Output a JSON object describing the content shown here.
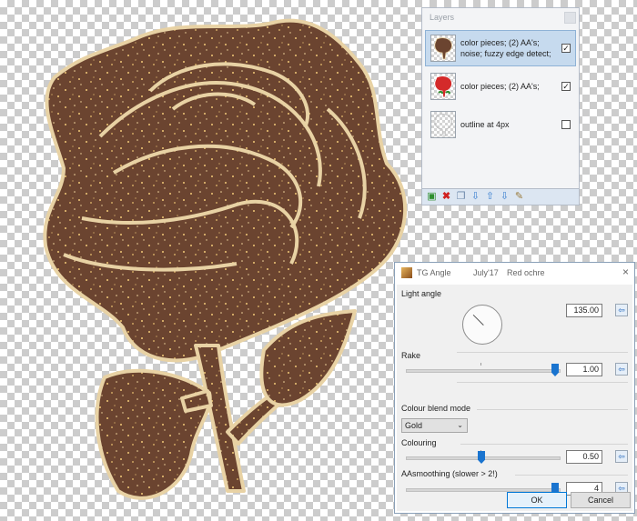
{
  "layers_panel": {
    "title": "Layers",
    "layers": [
      {
        "name": "color pieces; (2) AA's; noise; fuzzy edge detect;",
        "checked": true,
        "selected": true,
        "thumb": "brown-rose"
      },
      {
        "name": "color pieces; (2) AA's;",
        "checked": true,
        "selected": false,
        "thumb": "red-rose"
      },
      {
        "name": "outline at 4px",
        "checked": false,
        "selected": false,
        "thumb": "outline-rose"
      }
    ],
    "toolbar_icons": [
      "add-layer-icon",
      "delete-layer-icon",
      "duplicate-layer-icon",
      "merge-down-icon",
      "move-up-icon",
      "move-down-icon",
      "properties-icon"
    ],
    "check_mark": "✓"
  },
  "dialog": {
    "title": "TG Angle",
    "subtitle": "July'17",
    "subtitle2": "Red ochre",
    "close": "×",
    "light_angle": {
      "label": "Light angle",
      "value": "135.00"
    },
    "rake": {
      "label": "Rake",
      "value": "1.00",
      "fraction": 1.0
    },
    "blend_mode": {
      "label": "Colour blend mode",
      "selected": "Gold"
    },
    "colouring": {
      "label": "Colouring",
      "value": "0.50",
      "fraction": 0.5
    },
    "aasmoothing": {
      "label": "AAsmoothing (slower > 2!)",
      "value": "4",
      "fraction": 1.0
    },
    "reset_glyph": "⇦",
    "caret": "⌄",
    "ok": "OK",
    "cancel": "Cancel"
  },
  "colors": {
    "rose_fill": "#6e4730",
    "rose_outline": "#e8d2a4",
    "speckle": "#f0c878",
    "accent": "#1a74cf"
  }
}
